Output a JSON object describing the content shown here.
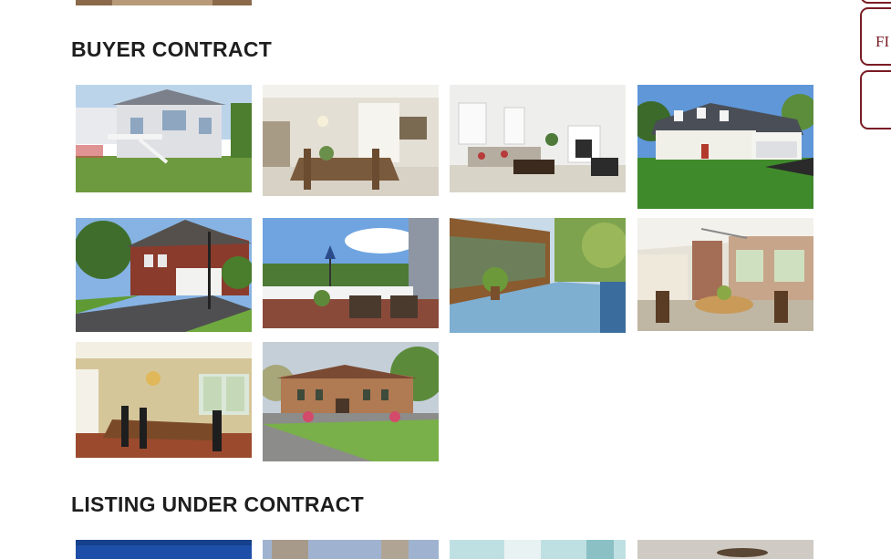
{
  "sections": {
    "buyer_contract_title": "BUYER CONTRACT",
    "listing_under_contract_title": "LISTING UNDER CONTRACT"
  },
  "side_buttons": {
    "first_label": "FI",
    "second_label": ""
  },
  "colors": {
    "accent": "#7a1c25",
    "heading": "#1e1e1e"
  }
}
